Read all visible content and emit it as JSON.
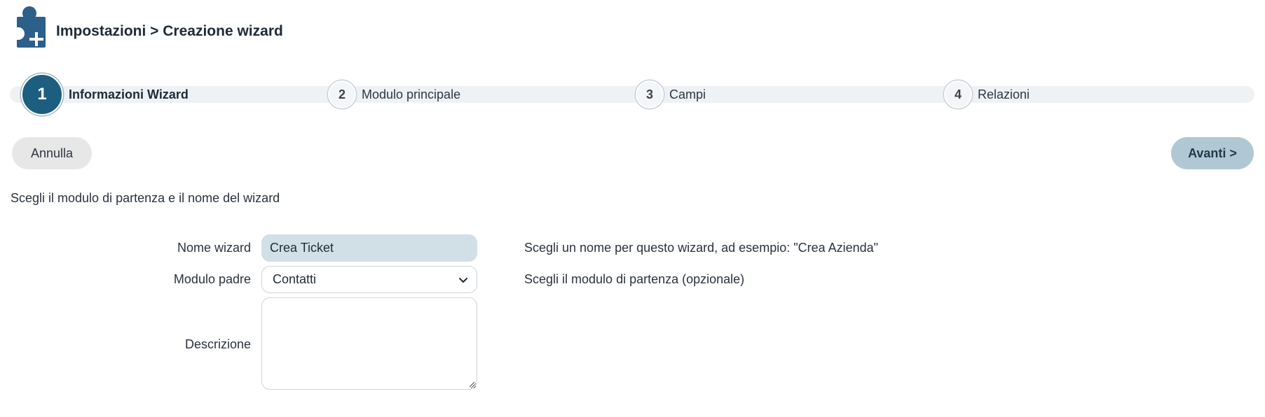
{
  "header": {
    "title": "Impostazioni > Creazione wizard",
    "logo_icon": "puzzle-plus-icon"
  },
  "stepper": {
    "steps": [
      {
        "number": "1",
        "label": "Informazioni Wizard",
        "active": true
      },
      {
        "number": "2",
        "label": "Modulo principale",
        "active": false
      },
      {
        "number": "3",
        "label": "Campi",
        "active": false
      },
      {
        "number": "4",
        "label": "Relazioni",
        "active": false
      }
    ]
  },
  "actions": {
    "cancel_label": "Annulla",
    "next_label": "Avanti >"
  },
  "intro": "Scegli il modulo di partenza e il nome del wizard",
  "form": {
    "name": {
      "label": "Nome wizard",
      "value": "Crea Ticket",
      "help": "Scegli un nome per questo wizard, ad esempio: \"Crea Azienda\""
    },
    "parent_module": {
      "label": "Modulo padre",
      "selected": "Contatti",
      "help": "Scegli il modulo di partenza (opzionale)"
    },
    "description": {
      "label": "Descrizione",
      "value": ""
    }
  },
  "colors": {
    "primary": "#1b5e80",
    "logo": "#2c5f8a",
    "next_button": "#afc8d3",
    "name_input_bg": "#d1e0e6"
  }
}
